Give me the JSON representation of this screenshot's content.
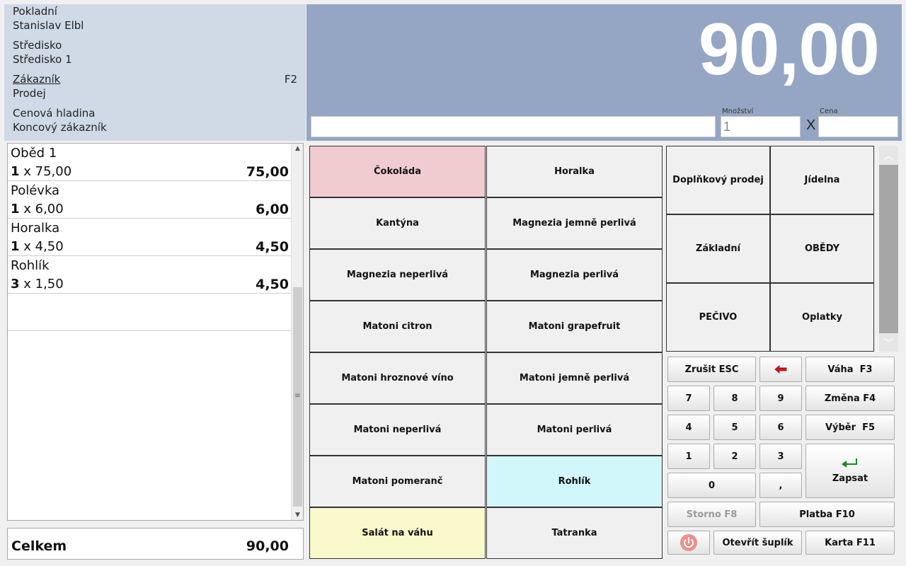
{
  "info": {
    "cashier_label": "Pokladní",
    "cashier_name": "Stanislav Elbl",
    "center_label": "Středisko",
    "center_value": "Středisko 1",
    "customer_label": "Zákazník",
    "customer_shortcut": "F2",
    "customer_value": "Prodej",
    "price_level_label": "Cenová hladina",
    "price_level_value": "Koncový zákazník"
  },
  "display": {
    "total": "90,00",
    "quantity_label": "Množství",
    "quantity_value": "1",
    "times_sign": "X",
    "price_label": "Cena"
  },
  "receipt": {
    "items": [
      {
        "name": "Oběd 1",
        "qty": "1",
        "unit": " x 75,00",
        "sum": "75,00"
      },
      {
        "name": "Polévka",
        "qty": "1",
        "unit": " x 6,00",
        "sum": "6,00"
      },
      {
        "name": "Horalka",
        "qty": "1",
        "unit": " x 4,50",
        "sum": "4,50"
      },
      {
        "name": "Rohlík",
        "qty": "3",
        "unit": " x 1,50",
        "sum": "4,50"
      }
    ],
    "total_label": "Celkem",
    "total_value": "90,00"
  },
  "products": [
    {
      "label": "Čokoláda",
      "color": "#f0ccd1"
    },
    {
      "label": "Horalka",
      "color": "#f0f0f0"
    },
    {
      "label": "Kantýna",
      "color": "#f0f0f0"
    },
    {
      "label": "Magnezia jemně perlivá",
      "color": "#f0f0f0"
    },
    {
      "label": "Magnezia neperlivá",
      "color": "#f0f0f0"
    },
    {
      "label": "Magnezia perlivá",
      "color": "#f0f0f0"
    },
    {
      "label": "Matoni citron",
      "color": "#f0f0f0"
    },
    {
      "label": "Matoni grapefruit",
      "color": "#f0f0f0"
    },
    {
      "label": "Matoni hroznové víno",
      "color": "#f0f0f0"
    },
    {
      "label": "Matoni jemně perlivá",
      "color": "#f0f0f0"
    },
    {
      "label": "Matoni neperlivá",
      "color": "#f0f0f0"
    },
    {
      "label": "Matoni perlivá",
      "color": "#f0f0f0"
    },
    {
      "label": "Matoni pomeranč",
      "color": "#f0f0f0"
    },
    {
      "label": "Rohlík",
      "color": "#d2f7fa"
    },
    {
      "label": "Salát na váhu",
      "color": "#f9f9cc"
    },
    {
      "label": "Tatranka",
      "color": "#f0f0f0"
    }
  ],
  "categories": [
    {
      "label": "Doplňkový prodej"
    },
    {
      "label": "Jídelna"
    },
    {
      "label": "Základní"
    },
    {
      "label": "OBĚDY"
    },
    {
      "label": "PEČIVO"
    },
    {
      "label": "Oplatky"
    }
  ],
  "keypad": {
    "cancel": "Zrušit ESC",
    "scale": "Váha  F3",
    "k7": "7",
    "k8": "8",
    "k9": "9",
    "change": "Změna F4",
    "k4": "4",
    "k5": "5",
    "k6": "6",
    "select": "Výběr  F5",
    "k1": "1",
    "k2": "2",
    "k3": "3",
    "k0": "0",
    "comma": ",",
    "enter": "Zapsat",
    "storno": "Storno F8",
    "payment": "Platba F10",
    "drawer": "Otevřít šuplík",
    "card": "Karta F11"
  },
  "colors": {
    "info_bg": "#cfdae6",
    "display_bg": "#94a6c4",
    "backspace_arrow": "#d8141c",
    "enter_arrow": "#1a8a1a",
    "power_icon": "#f08e8e"
  },
  "icons": {
    "backspace": "backspace-arrow-icon",
    "enter": "enter-arrow-icon",
    "power": "power-icon"
  }
}
